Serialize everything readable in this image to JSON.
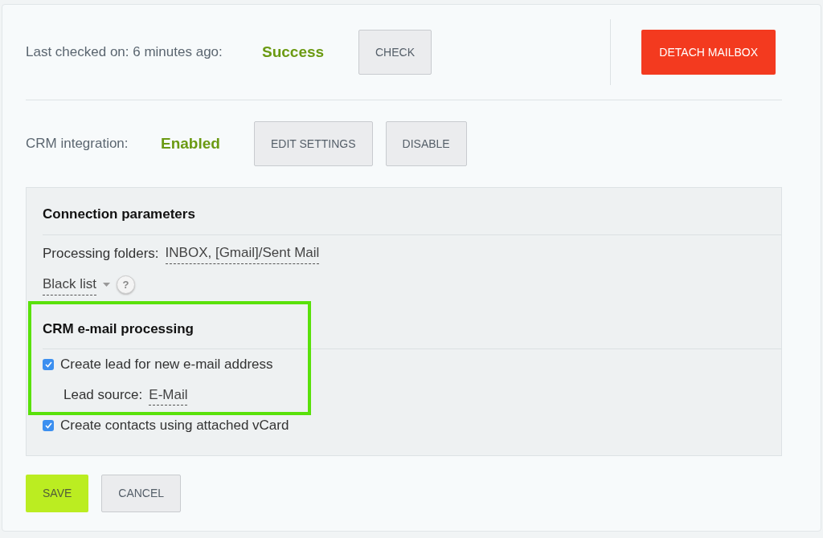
{
  "mailbox_status": {
    "label": "Last checked on: 6 minutes ago:",
    "status": "Success",
    "check_button": "CHECK",
    "detach_button": "DETACH MAILBOX"
  },
  "crm_integration": {
    "label": "CRM integration:",
    "status": "Enabled",
    "buttons": [
      "EDIT SETTINGS",
      "DISABLE"
    ]
  },
  "connection_parameters": {
    "title": "Connection parameters",
    "folders_label": "Processing folders:",
    "folders_value": "INBOX, [Gmail]/Sent Mail",
    "black_list": "Black list",
    "help": "?"
  },
  "crm_processing": {
    "title": "CRM e-mail processing",
    "highlighted": true,
    "options": [
      {
        "kind": "checkbox",
        "label": "Create lead for new e-mail address",
        "checked": true
      },
      {
        "kind": "field",
        "label": "Lead source:",
        "value": "E-Mail"
      },
      {
        "kind": "checkbox",
        "label": "Create contacts using attached vCard",
        "checked": true
      }
    ]
  },
  "footer_buttons": [
    {
      "label": "SAVE",
      "kind": "primary"
    },
    {
      "label": "CANCEL",
      "kind": "secondary"
    }
  ]
}
